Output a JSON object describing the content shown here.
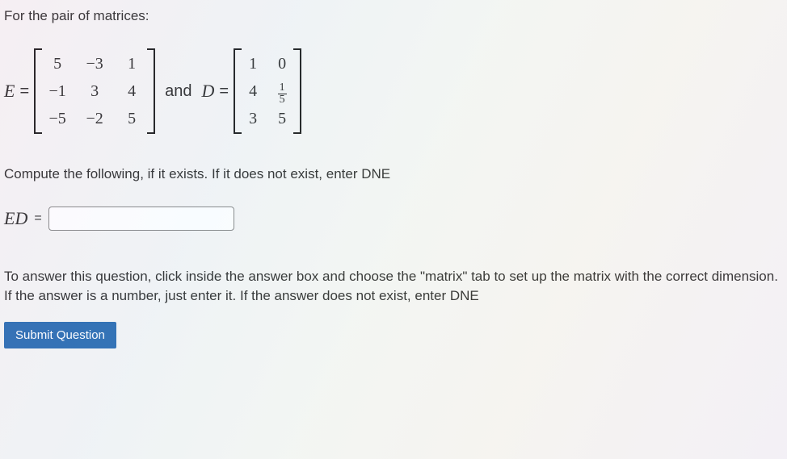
{
  "intro": "For the pair of matrices:",
  "matrixE": {
    "label": "E",
    "eq": "=",
    "cells": [
      "5",
      "−3",
      "1",
      "−1",
      "3",
      "4",
      "−5",
      "−2",
      "5"
    ]
  },
  "and": "and",
  "matrixD": {
    "label": "D",
    "eq": "=",
    "cells": [
      "1",
      "0",
      "4",
      "FRAC_1_5",
      "3",
      "5"
    ]
  },
  "instruction": "Compute the following, if it does not exist, enter DNE",
  "instruction_full": "Compute the following, if it exists. If it does not exist, enter DNE",
  "answer": {
    "label": "ED",
    "eq": "=",
    "value": ""
  },
  "hint": "To answer this question, click inside the answer box and choose the \"matrix\" tab to set up the matrix with the correct dimension. If the answer is a number, just enter it. If the answer does not exist, enter DNE",
  "submit": "Submit Question"
}
